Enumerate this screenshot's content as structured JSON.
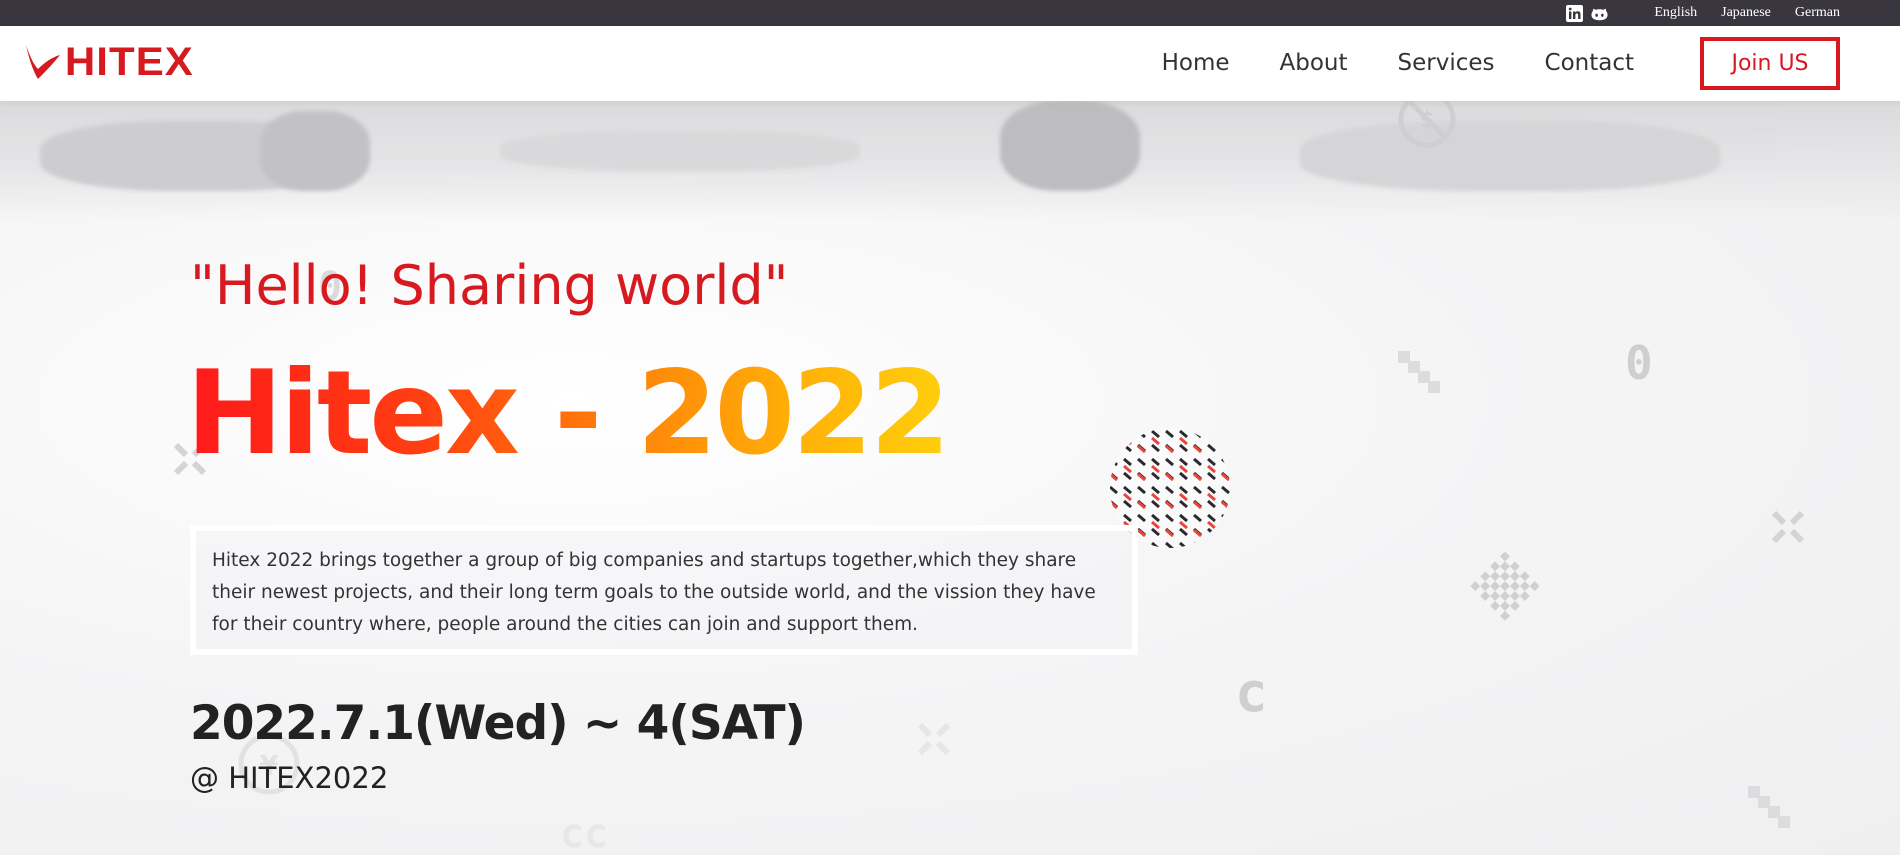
{
  "topbar": {
    "social": [
      {
        "icon": "linkedin-icon"
      },
      {
        "icon": "github-icon"
      }
    ],
    "languages": [
      "English",
      "Japanese",
      "German"
    ]
  },
  "header": {
    "logo_text": "HITEX",
    "nav": [
      "Home",
      "About",
      "Services",
      "Contact"
    ],
    "join_label": "Join US"
  },
  "hero": {
    "tagline": "\"Hello! Sharing world\"",
    "headline": "Hitex - 2022",
    "description": "Hitex 2022 brings together a group of big companies and startups together,which they share their newest projects, and their long term goals to the outside world, and the vission they have for their country where, people around the cities can join and support them.",
    "date": "2022.7.1(Wed) ~ 4(SAT)",
    "venue": "@ HITEX2022"
  },
  "colors": {
    "brand_red": "#d71920",
    "topbar_bg": "#393640",
    "headline_gradient_start": "#ff1a1a",
    "headline_gradient_end": "#ffcf0c"
  }
}
